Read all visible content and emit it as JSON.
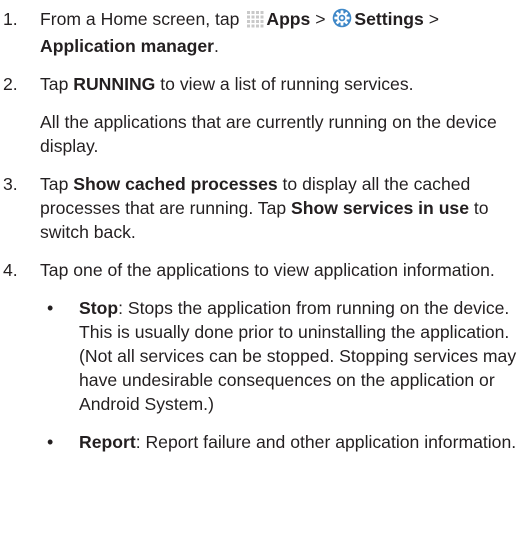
{
  "steps": [
    {
      "number": "1.",
      "text_a": "From a Home screen, tap ",
      "apps_label": "Apps",
      "sep1": " > ",
      "settings_label": "Settings",
      "sep2": " > ",
      "app_manager_label": "Application manager",
      "end": "."
    },
    {
      "number": "2.",
      "text_a": "Tap ",
      "running_label": "RUNNING",
      "text_b": " to view a list of running services.",
      "note": "All the applications that are currently running on the device display."
    },
    {
      "number": "3.",
      "text_a": "Tap ",
      "cached_label": "Show cached processes",
      "text_b": " to display all the cached processes that are running. Tap ",
      "services_label": "Show services in use",
      "text_c": " to switch back."
    },
    {
      "number": "4.",
      "text": "Tap one of the applications to view application information.",
      "bullets": [
        {
          "bullet": "•",
          "label": "Stop",
          "text": ": Stops the application from running on the device. This is usually done prior to uninstalling the application. (Not all services can be stopped. Stopping services may have undesirable consequences on the application or Android System.)"
        },
        {
          "bullet": "•",
          "label": "Report",
          "text": ": Report failure and other application information."
        }
      ]
    }
  ],
  "icons": {
    "apps": "apps-grid-icon",
    "settings": "settings-gear-icon"
  },
  "colors": {
    "text": "#231f20",
    "apps_icon": "#c9c9c9",
    "settings_icon": "#3f88c8"
  }
}
